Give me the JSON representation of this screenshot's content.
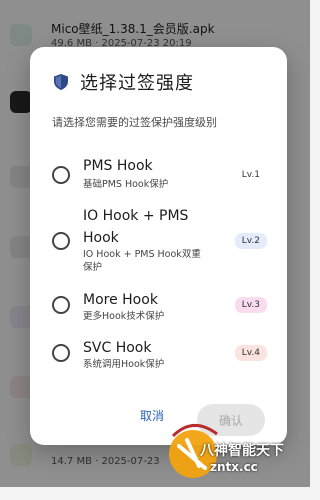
{
  "background": {
    "top_item": {
      "title": "Mico壁纸_1.38.1_会员版.apk",
      "meta": "49.6 MB · 2025-07-23 20:19"
    },
    "bottom_item": {
      "meta": "14.7 MB · 2025-07-23"
    }
  },
  "dialog": {
    "title": "选择过签强度",
    "subtitle": "请选择您需要的过签保护强度级别",
    "options": [
      {
        "title": "PMS Hook",
        "desc": "基础PMS Hook保护",
        "level": "Lv.1",
        "badge_color": "#ffffff"
      },
      {
        "title_line1": "IO Hook + PMS",
        "title_line2": "Hook",
        "desc_line1": "IO Hook + PMS Hook双重",
        "desc_line2": "保护",
        "level": "Lv.2",
        "badge_color": "#e4ebfb"
      },
      {
        "title": "More Hook",
        "desc": "更多Hook技术保护",
        "level": "Lv.3",
        "badge_color": "#f9dcef"
      },
      {
        "title": "SVC Hook",
        "desc": "系统调用Hook保护",
        "level": "Lv.4",
        "badge_color": "#fbe3df"
      }
    ],
    "cancel_label": "取消",
    "confirm_label": "确认"
  },
  "watermark": {
    "line1": "八神智能天下",
    "line2": "zntx.cc"
  }
}
